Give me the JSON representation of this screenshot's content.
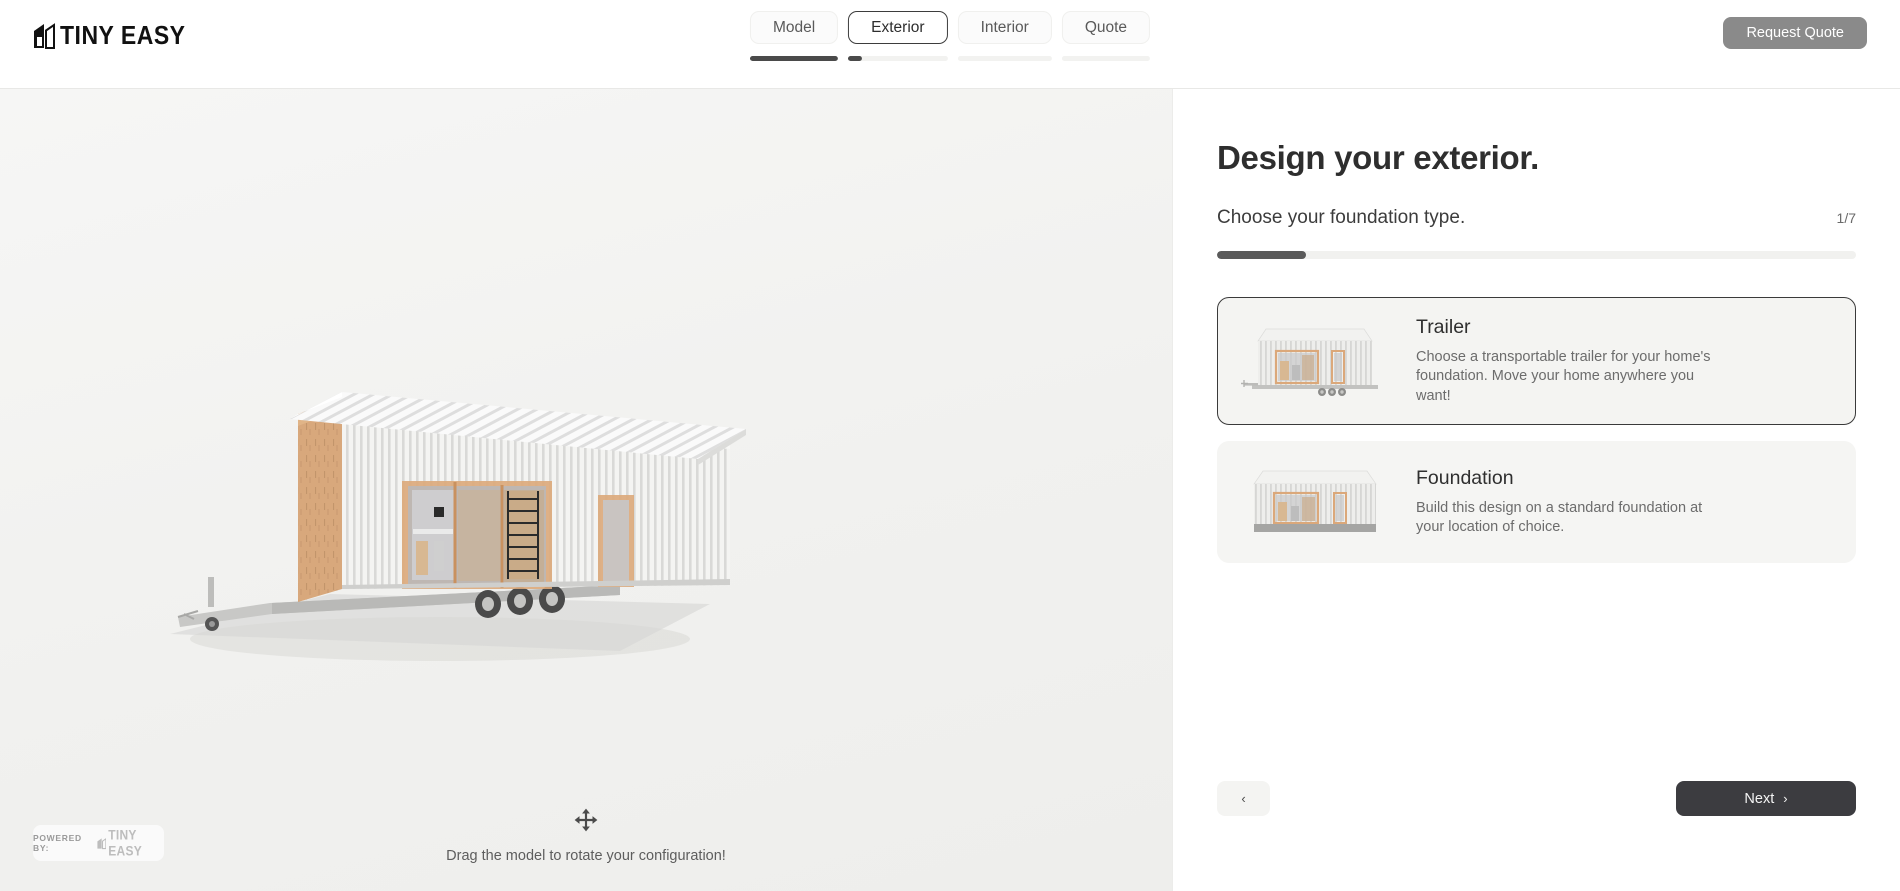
{
  "header": {
    "logo_text": "TINY EASY",
    "logo_icon": "house-logo-icon",
    "request_quote_label": "Request Quote",
    "tabs": [
      {
        "label": "Model",
        "progress": 100,
        "active": false
      },
      {
        "label": "Exterior",
        "progress": 14,
        "active": true
      },
      {
        "label": "Interior",
        "progress": 0,
        "active": false
      },
      {
        "label": "Quote",
        "progress": 0,
        "active": false
      }
    ]
  },
  "viewport": {
    "drag_hint": "Drag the model to rotate your configuration!",
    "drag_icon": "move-arrows-icon",
    "powered_by_label": "POWERED BY:",
    "powered_by_brand": "TINY EASY",
    "model_description": "tiny-home-on-trailer-3d-model"
  },
  "panel": {
    "title": "Design your exterior.",
    "subtitle": "Choose your foundation type.",
    "step_counter": "1/7",
    "step_progress_percent": 14,
    "options": [
      {
        "name": "Trailer",
        "description": "Choose a transportable trailer for your home's foundation. Move your home anywhere you want!",
        "thumb": "tiny-home-trailer-thumbnail",
        "selected": true
      },
      {
        "name": "Foundation",
        "description": "Build this design on a standard foundation at your location of choice.",
        "thumb": "tiny-home-foundation-thumbnail",
        "selected": false
      }
    ],
    "back_label": "‹",
    "next_label": "Next",
    "next_chevron": "›"
  },
  "colors": {
    "accent_dark": "#3c3c40",
    "viewport_bg": "#f1f1ef",
    "card_bg": "#f5f5f3",
    "selected_border": "#3a3a3a",
    "request_quote_bg": "#8a8a8a",
    "timber": "#d9a97a",
    "siding": "#e9e9e7"
  }
}
